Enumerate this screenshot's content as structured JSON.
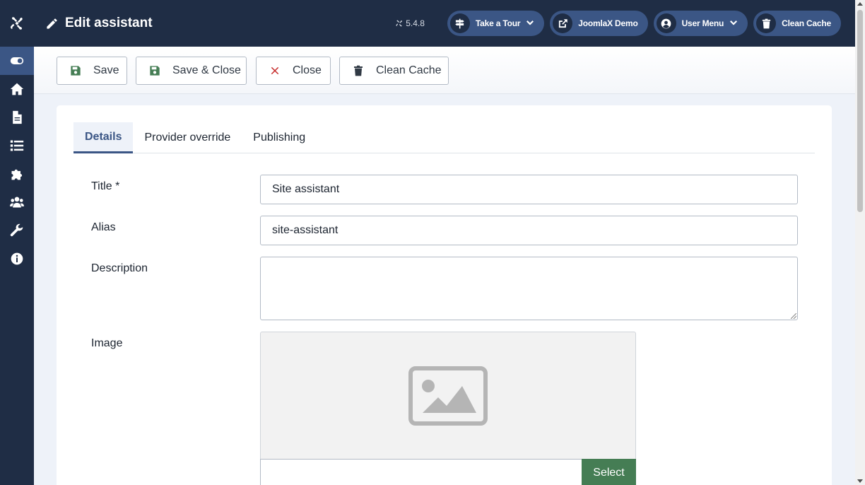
{
  "header": {
    "title": "Edit assistant",
    "version": "5.4.8",
    "buttons": {
      "tour": "Take a Tour",
      "demo": "JoomlaX Demo",
      "user_menu": "User Menu",
      "clean_cache": "Clean Cache"
    }
  },
  "sidebar": {
    "items": [
      "toggle-menu-icon",
      "home-icon",
      "document-icon",
      "list-icon",
      "puzzle-icon",
      "users-icon",
      "wrench-icon",
      "info-icon"
    ]
  },
  "toolbar": {
    "save_label": "Save",
    "save_close_label": "Save & Close",
    "close_label": "Close",
    "clean_cache_label": "Clean Cache"
  },
  "tabs": [
    {
      "label": "Details",
      "active": true
    },
    {
      "label": "Provider override",
      "active": false
    },
    {
      "label": "Publishing",
      "active": false
    }
  ],
  "form": {
    "title_label": "Title *",
    "title_value": "Site assistant",
    "alias_label": "Alias",
    "alias_value": "site-assistant",
    "description_label": "Description",
    "description_value": "",
    "image_label": "Image",
    "image_select_label": "Select"
  },
  "colors": {
    "sidebar_bg": "#1f2d45",
    "accent": "#3b5685",
    "save_green": "#457d54",
    "close_red": "#c52827"
  }
}
